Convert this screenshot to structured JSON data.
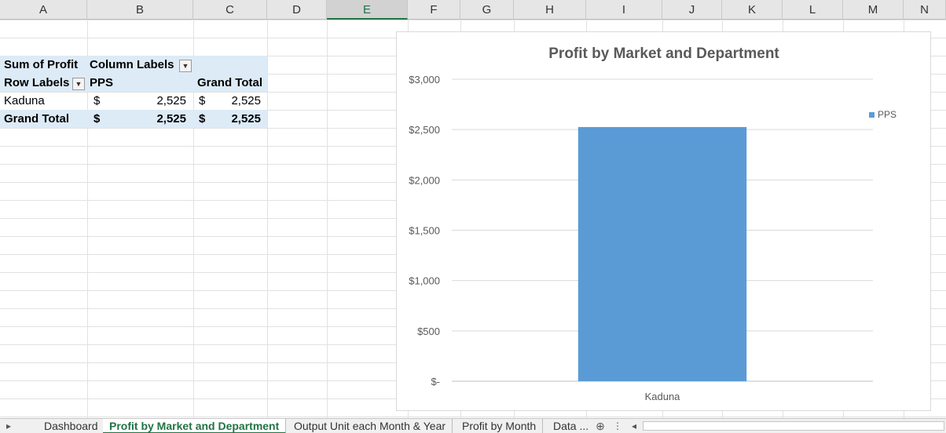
{
  "columns": [
    "A",
    "B",
    "C",
    "D",
    "E",
    "F",
    "G",
    "H",
    "I",
    "J",
    "K",
    "L",
    "M",
    "N"
  ],
  "selected_column": "E",
  "pivot": {
    "sum_label": "Sum of Profit",
    "col_labels": "Column Labels",
    "row_labels": "Row Labels",
    "col_item": "PPS",
    "grand_total_header": "Grand Total",
    "rows": [
      {
        "label": "Kaduna",
        "cur1": "$",
        "val1": "2,525",
        "cur2": "$",
        "val2": "2,525"
      }
    ],
    "grand_total": {
      "label": "Grand Total",
      "cur1": "$",
      "val1": "2,525",
      "cur2": "$",
      "val2": "2,525"
    }
  },
  "chart_data": {
    "type": "bar",
    "title": "Profit by Market and Department",
    "categories": [
      "Kaduna"
    ],
    "series": [
      {
        "name": "PPS",
        "values": [
          2525
        ],
        "color": "#5b9bd5"
      }
    ],
    "ylim": [
      0,
      3000
    ],
    "yticks": [
      0,
      500,
      1000,
      1500,
      2000,
      2500,
      3000
    ],
    "ytick_labels": [
      "$-",
      "$500",
      "$1,000",
      "$1,500",
      "$2,000",
      "$2,500",
      "$3,000"
    ],
    "grid": true,
    "legend": "right"
  },
  "tabs": {
    "items": [
      "Dashboard",
      "Profit by Market and Department",
      "Output Unit each Month & Year",
      "Profit by Month",
      "Data ..."
    ],
    "active": "Profit by Market and Department"
  },
  "icons": {
    "nav_prev": "▸",
    "add": "⊕",
    "more": "⋮",
    "scroll_left": "◂",
    "filter": "▼"
  }
}
